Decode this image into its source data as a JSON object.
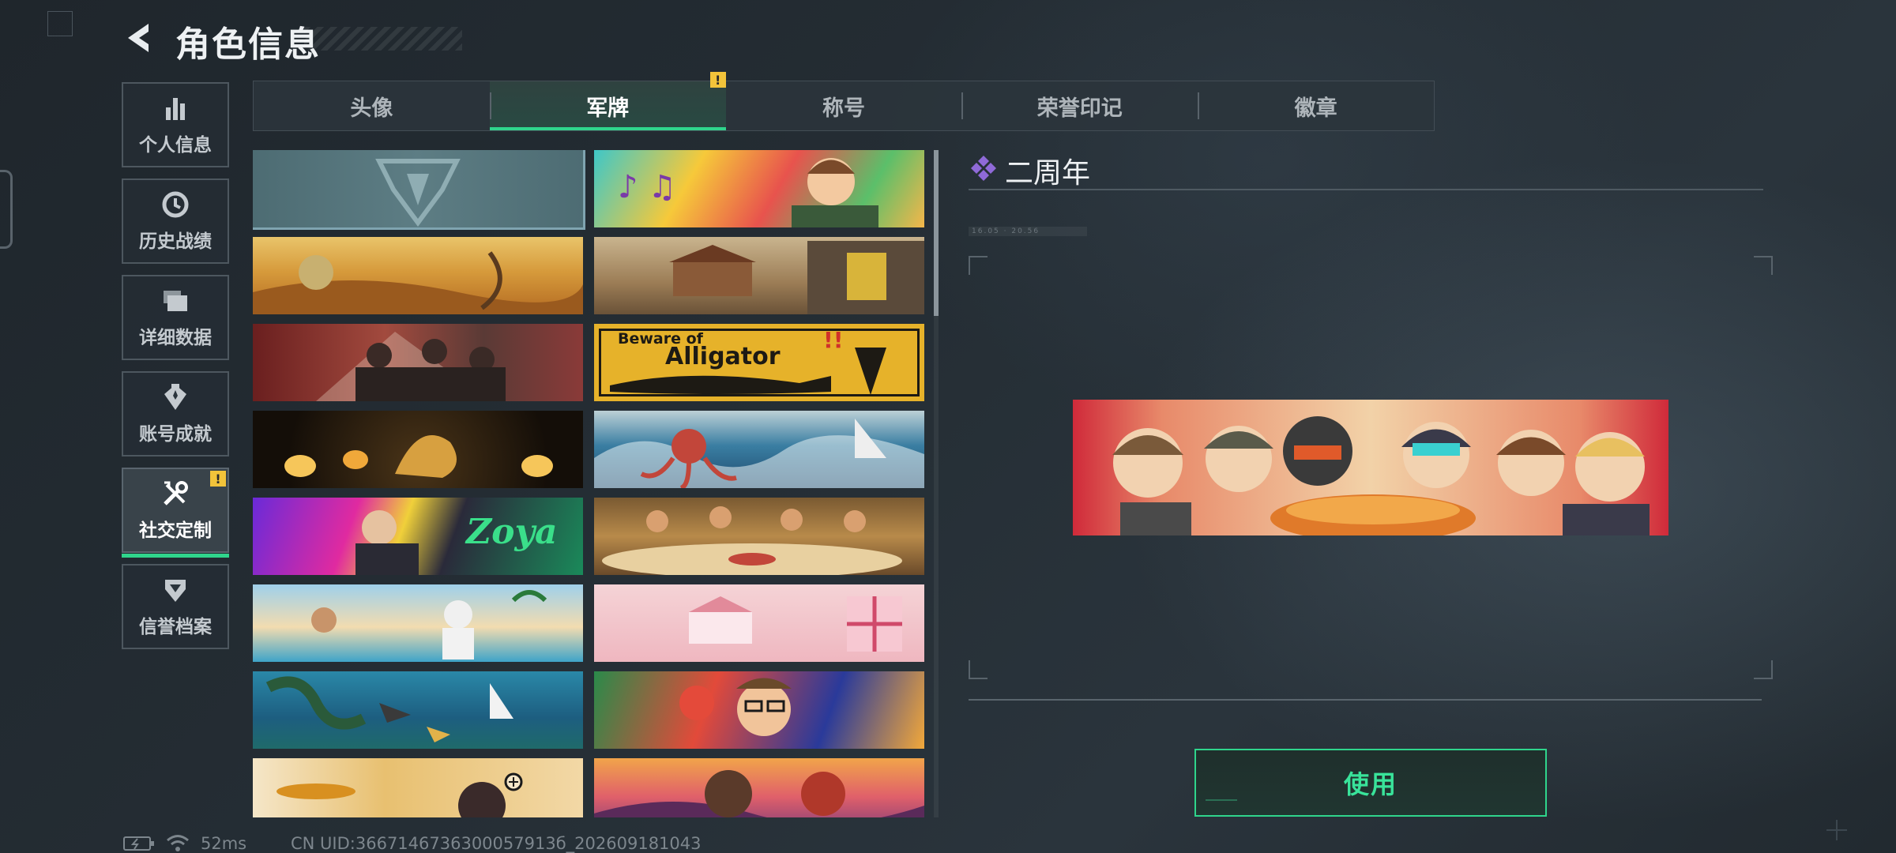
{
  "header": {
    "title": "角色信息"
  },
  "sidebar": {
    "items": [
      {
        "label": "个人信息",
        "icon": "bar-chart-icon"
      },
      {
        "label": "历史战绩",
        "icon": "history-clock-icon"
      },
      {
        "label": "详细数据",
        "icon": "folder-stack-icon"
      },
      {
        "label": "账号成就",
        "icon": "achievement-icon"
      },
      {
        "label": "社交定制",
        "icon": "tools-icon",
        "active": true,
        "badge": "!"
      },
      {
        "label": "信誉档案",
        "icon": "reputation-icon"
      }
    ]
  },
  "tabs": [
    {
      "label": "头像"
    },
    {
      "label": "军牌",
      "active": true,
      "badge": "!"
    },
    {
      "label": "称号"
    },
    {
      "label": "荣誉印记"
    },
    {
      "label": "徽章"
    }
  ],
  "cards": {
    "beware_line1": "Beware of",
    "beware_line2": "Alligator",
    "zoya_text": "Zoya"
  },
  "detail": {
    "title": "二周年",
    "date": "16.05 · 20.56",
    "use_label": "使用"
  },
  "footer": {
    "ping": "52ms",
    "uid": "CN UID:3667146736300057913б_202609181043"
  },
  "colors": {
    "accent": "#2fd58c",
    "badge": "#f2c33a",
    "title_icon": "#8f6ad8"
  }
}
